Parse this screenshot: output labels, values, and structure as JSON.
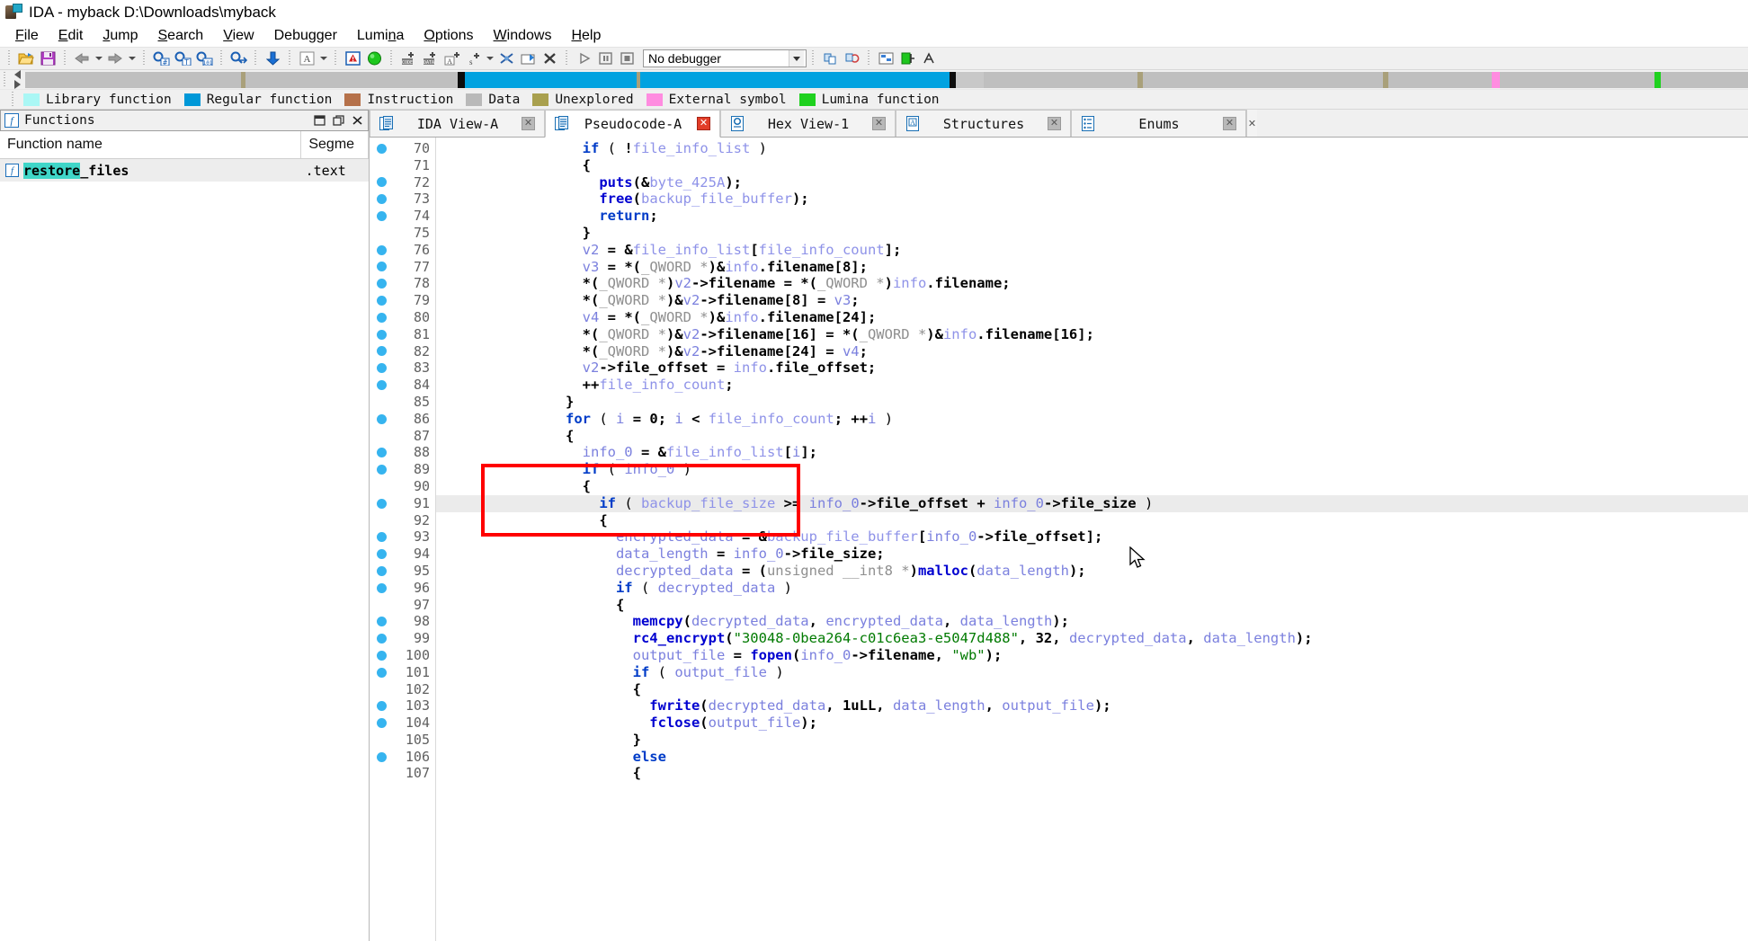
{
  "window": {
    "title": "IDA - myback D:\\Downloads\\myback",
    "app_icon": "ida-logo-icon"
  },
  "menubar": {
    "items": [
      {
        "label": "File",
        "accel": "F"
      },
      {
        "label": "Edit",
        "accel": "E"
      },
      {
        "label": "Jump",
        "accel": "J"
      },
      {
        "label": "Search",
        "accel": "S"
      },
      {
        "label": "View",
        "accel": "V"
      },
      {
        "label": "Debugger",
        "accel": "g"
      },
      {
        "label": "Lumina",
        "accel": "n"
      },
      {
        "label": "Options",
        "accel": "O"
      },
      {
        "label": "Windows",
        "accel": "W"
      },
      {
        "label": "Help",
        "accel": "H"
      }
    ]
  },
  "toolbar": {
    "debugger_value": "No debugger",
    "buttons": [
      "open-file-icon",
      "save-icon",
      "nav-back-icon",
      "nav-back-dropdown-icon",
      "nav-forward-icon",
      "nav-forward-dropdown-icon",
      "search-next-code-icon",
      "search-text-icon",
      "search-binary-icon",
      "jump-to-icon",
      "jump-down-icon",
      "ascii-icon",
      "ascii-dropdown-icon",
      "warning-icon",
      "run-green-icon",
      "make-code-icon",
      "make-data-icon",
      "make-ascii-icon",
      "make-struct-icon",
      "make-dropdown-icon",
      "undefine-icon",
      "rename-icon",
      "delete-icon",
      "debug-run-icon",
      "debug-pause-icon",
      "debug-stop-icon"
    ]
  },
  "navigator": {
    "segments": [
      {
        "color": "#bfbfbf",
        "width_pct": 12.6
      },
      {
        "color": "#a9a07a",
        "width_pct": 0.22
      },
      {
        "color": "#bfbfbf",
        "width_pct": 12.4
      },
      {
        "color": "#0d0d0d",
        "width_pct": 0.4
      },
      {
        "color": "#00a2e0",
        "width_pct": 10.0
      },
      {
        "color": "#a9a07a",
        "width_pct": 0.22
      },
      {
        "color": "#00a2e0",
        "width_pct": 18.0
      },
      {
        "color": "#0d0d0d",
        "width_pct": 0.4
      },
      {
        "color": "#c8c8c8",
        "width_pct": 1.6
      },
      {
        "color": "#bfbfbf",
        "width_pct": 9.0
      },
      {
        "color": "#a9a07a",
        "width_pct": 0.3
      },
      {
        "color": "#bfbfbf",
        "width_pct": 14.0
      },
      {
        "color": "#a9a07a",
        "width_pct": 0.3
      },
      {
        "color": "#bfbfbf",
        "width_pct": 6.0
      },
      {
        "color": "#ff8ce0",
        "width_pct": 0.5
      },
      {
        "color": "#bfbfbf",
        "width_pct": 9.0
      },
      {
        "color": "#1fd11f",
        "width_pct": 0.4
      },
      {
        "color": "#bfbfbf",
        "width_pct": 5.06
      }
    ]
  },
  "legend": {
    "items": [
      {
        "label": "Library function",
        "color": "#aaf7f5"
      },
      {
        "label": "Regular function",
        "color": "#0098d8"
      },
      {
        "label": "Instruction",
        "color": "#b5714a"
      },
      {
        "label": "Data",
        "color": "#b9b9b9"
      },
      {
        "label": "Unexplored",
        "color": "#a9a04e"
      },
      {
        "label": "External symbol",
        "color": "#ff8ce0"
      },
      {
        "label": "Lumina function",
        "color": "#1fd11f"
      }
    ]
  },
  "functions_panel": {
    "title": "Functions",
    "icon": "function-f-icon",
    "window_buttons": [
      "minimize-icon",
      "restore-icon",
      "close-icon"
    ],
    "columns": [
      "Function name",
      "Segme"
    ],
    "rows": [
      {
        "icon": "function-f-icon",
        "name_highlighted": "restore",
        "name_rest": "_files",
        "segment": ".text",
        "selected": true
      }
    ]
  },
  "tabs": [
    {
      "label": "IDA View-A",
      "icon": "document-icon",
      "active": false,
      "close": "close-icon",
      "close_style": "grey"
    },
    {
      "label": "Pseudocode-A",
      "icon": "document-icon",
      "active": true,
      "close": "close-icon",
      "close_style": "red"
    },
    {
      "label": "Hex View-1",
      "icon": "hex-icon",
      "active": false,
      "close": "close-icon",
      "close_style": "grey"
    },
    {
      "label": "Structures",
      "icon": "structures-icon",
      "active": false,
      "close": "close-icon",
      "close_style": "grey"
    },
    {
      "label": "Enums",
      "icon": "enums-icon",
      "active": false,
      "close": "close-icon",
      "close_style": "grey"
    }
  ],
  "code": {
    "current_line": 91,
    "highlight_box": {
      "from_line": 88,
      "to_line": 91,
      "color": "#ff0000"
    },
    "lines": [
      {
        "n": 70,
        "bp": true,
        "html": "                 <span class=\"kw\">if</span> <span class=\"pln\">( </span><span class=\"bld\">!</span><span class=\"glb\">file_info_list</span> <span class=\"pln\">)</span>"
      },
      {
        "n": 71,
        "bp": false,
        "html": "                 <span class=\"bld\">{</span>"
      },
      {
        "n": 72,
        "bp": true,
        "html": "                   <span class=\"fn\">puts</span><span class=\"bld\">(&amp;</span><span class=\"glb\">byte_425A</span><span class=\"bld\">);</span>"
      },
      {
        "n": 73,
        "bp": true,
        "html": "                   <span class=\"fn\">free</span><span class=\"bld\">(</span><span class=\"glb\">backup_file_buffer</span><span class=\"bld\">);</span>"
      },
      {
        "n": 74,
        "bp": true,
        "html": "                   <span class=\"kw\">return</span><span class=\"bld\">;</span>"
      },
      {
        "n": 75,
        "bp": false,
        "html": "                 <span class=\"bld\">}</span>"
      },
      {
        "n": 76,
        "bp": true,
        "html": "                 <span class=\"var\">v2</span> <span class=\"bld\">= &amp;</span><span class=\"glb\">file_info_list</span><span class=\"bld\">[</span><span class=\"glb\">file_info_count</span><span class=\"bld\">];</span>"
      },
      {
        "n": 77,
        "bp": true,
        "html": "                 <span class=\"var\">v3</span> <span class=\"bld\">= *(</span><span class=\"typ\">_QWORD *</span><span class=\"bld\">)&amp;</span><span class=\"glb\">info</span><span class=\"bld\">.filename[8];</span>"
      },
      {
        "n": 78,
        "bp": true,
        "html": "                 <span class=\"bld\">*(</span><span class=\"typ\">_QWORD *</span><span class=\"bld\">)</span><span class=\"var\">v2</span><span class=\"bld\">-&gt;filename = *(</span><span class=\"typ\">_QWORD *</span><span class=\"bld\">)</span><span class=\"glb\">info</span><span class=\"bld\">.filename;</span>"
      },
      {
        "n": 79,
        "bp": true,
        "html": "                 <span class=\"bld\">*(</span><span class=\"typ\">_QWORD *</span><span class=\"bld\">)&amp;</span><span class=\"var\">v2</span><span class=\"bld\">-&gt;filename[8] = </span><span class=\"var\">v3</span><span class=\"bld\">;</span>"
      },
      {
        "n": 80,
        "bp": true,
        "html": "                 <span class=\"var\">v4</span> <span class=\"bld\">= *(</span><span class=\"typ\">_QWORD *</span><span class=\"bld\">)&amp;</span><span class=\"glb\">info</span><span class=\"bld\">.filename[24];</span>"
      },
      {
        "n": 81,
        "bp": true,
        "html": "                 <span class=\"bld\">*(</span><span class=\"typ\">_QWORD *</span><span class=\"bld\">)&amp;</span><span class=\"var\">v2</span><span class=\"bld\">-&gt;filename[16] = *(</span><span class=\"typ\">_QWORD *</span><span class=\"bld\">)&amp;</span><span class=\"glb\">info</span><span class=\"bld\">.filename[16];</span>"
      },
      {
        "n": 82,
        "bp": true,
        "html": "                 <span class=\"bld\">*(</span><span class=\"typ\">_QWORD *</span><span class=\"bld\">)&amp;</span><span class=\"var\">v2</span><span class=\"bld\">-&gt;filename[24] = </span><span class=\"var\">v4</span><span class=\"bld\">;</span>"
      },
      {
        "n": 83,
        "bp": true,
        "html": "                 <span class=\"var\">v2</span><span class=\"bld\">-&gt;file_offset = </span><span class=\"glb\">info</span><span class=\"bld\">.file_offset;</span>"
      },
      {
        "n": 84,
        "bp": true,
        "html": "                 <span class=\"bld\">++</span><span class=\"glb\">file_info_count</span><span class=\"bld\">;</span>"
      },
      {
        "n": 85,
        "bp": false,
        "html": "               <span class=\"bld\">}</span>"
      },
      {
        "n": 86,
        "bp": true,
        "html": "               <span class=\"kw\">for</span> <span class=\"pln\">( </span><span class=\"var\">i</span> <span class=\"bld\">= </span><span class=\"num\">0</span><span class=\"bld\">;</span> <span class=\"var\">i</span> <span class=\"bld\">&lt;</span> <span class=\"glb\">file_info_count</span><span class=\"bld\">; ++</span><span class=\"var\">i</span> <span class=\"pln\">)</span>"
      },
      {
        "n": 87,
        "bp": false,
        "html": "               <span class=\"bld\">{</span>"
      },
      {
        "n": 88,
        "bp": true,
        "html": "                 <span class=\"var\">info_0</span> <span class=\"bld\">= &amp;</span><span class=\"glb\">file_info_list</span><span class=\"bld\">[</span><span class=\"var\">i</span><span class=\"bld\">];</span>"
      },
      {
        "n": 89,
        "bp": true,
        "html": "                 <span class=\"kw\">if</span> <span class=\"pln\">( </span><span class=\"var\">info_0</span> <span class=\"pln\">)</span>"
      },
      {
        "n": 90,
        "bp": false,
        "html": "                 <span class=\"bld\">{</span>"
      },
      {
        "n": 91,
        "bp": true,
        "html": "                   <span class=\"kw\">if</span> <span class=\"pln\">( </span><span class=\"glb\">backup_file_size</span> <span class=\"bld\">&gt;=</span> <span class=\"var\">info_0</span><span class=\"bld\">-&gt;file_offset + </span><span class=\"var\">info_0</span><span class=\"bld\">-&gt;file_size</span> <span class=\"pln\">)</span>"
      },
      {
        "n": 92,
        "bp": false,
        "html": "                   <span class=\"bld\">{</span>"
      },
      {
        "n": 93,
        "bp": true,
        "html": "                     <span class=\"var\">encrypted_data</span> <span class=\"bld\">= &amp;</span><span class=\"glb\">backup_file_buffer</span><span class=\"bld\">[</span><span class=\"var\">info_0</span><span class=\"bld\">-&gt;file_offset];</span>"
      },
      {
        "n": 94,
        "bp": true,
        "html": "                     <span class=\"var\">data_length</span> <span class=\"bld\">= </span><span class=\"var\">info_0</span><span class=\"bld\">-&gt;file_size;</span>"
      },
      {
        "n": 95,
        "bp": true,
        "html": "                     <span class=\"var\">decrypted_data</span> <span class=\"bld\">= (</span><span class=\"typ\">unsigned __int8 *</span><span class=\"bld\">)</span><span class=\"fn\">malloc</span><span class=\"bld\">(</span><span class=\"var\">data_length</span><span class=\"bld\">);</span>"
      },
      {
        "n": 96,
        "bp": true,
        "html": "                     <span class=\"kw\">if</span> <span class=\"pln\">( </span><span class=\"var\">decrypted_data</span> <span class=\"pln\">)</span>"
      },
      {
        "n": 97,
        "bp": false,
        "html": "                     <span class=\"bld\">{</span>"
      },
      {
        "n": 98,
        "bp": true,
        "html": "                       <span class=\"fn\">memcpy</span><span class=\"bld\">(</span><span class=\"var\">decrypted_data</span><span class=\"bld\">, </span><span class=\"var\">encrypted_data</span><span class=\"bld\">, </span><span class=\"var\">data_length</span><span class=\"bld\">);</span>"
      },
      {
        "n": 99,
        "bp": true,
        "html": "                       <span class=\"fn\">rc4_encrypt</span><span class=\"bld\">(</span><span class=\"str\">\"30048-0bea264-c01c6ea3-e5047d488\"</span><span class=\"bld\">, </span><span class=\"num\">32</span><span class=\"bld\">, </span><span class=\"var\">decrypted_data</span><span class=\"bld\">, </span><span class=\"var\">data_length</span><span class=\"bld\">);</span>"
      },
      {
        "n": 100,
        "bp": true,
        "html": "                       <span class=\"var\">output_file</span> <span class=\"bld\">= </span><span class=\"fn\">fopen</span><span class=\"bld\">(</span><span class=\"var\">info_0</span><span class=\"bld\">-&gt;filename, </span><span class=\"str\">\"wb\"</span><span class=\"bld\">);</span>"
      },
      {
        "n": 101,
        "bp": true,
        "html": "                       <span class=\"kw\">if</span> <span class=\"pln\">( </span><span class=\"var\">output_file</span> <span class=\"pln\">)</span>"
      },
      {
        "n": 102,
        "bp": false,
        "html": "                       <span class=\"bld\">{</span>"
      },
      {
        "n": 103,
        "bp": true,
        "html": "                         <span class=\"fn\">fwrite</span><span class=\"bld\">(</span><span class=\"var\">decrypted_data</span><span class=\"bld\">, </span><span class=\"num\">1uLL</span><span class=\"bld\">, </span><span class=\"var\">data_length</span><span class=\"bld\">, </span><span class=\"var\">output_file</span><span class=\"bld\">);</span>"
      },
      {
        "n": 104,
        "bp": true,
        "html": "                         <span class=\"fn\">fclose</span><span class=\"bld\">(</span><span class=\"var\">output_file</span><span class=\"bld\">);</span>"
      },
      {
        "n": 105,
        "bp": false,
        "html": "                       <span class=\"bld\">}</span>"
      },
      {
        "n": 106,
        "bp": true,
        "html": "                       <span class=\"kw\">else</span>"
      },
      {
        "n": 107,
        "bp": false,
        "html": "                       <span class=\"bld\">{</span>"
      }
    ]
  }
}
